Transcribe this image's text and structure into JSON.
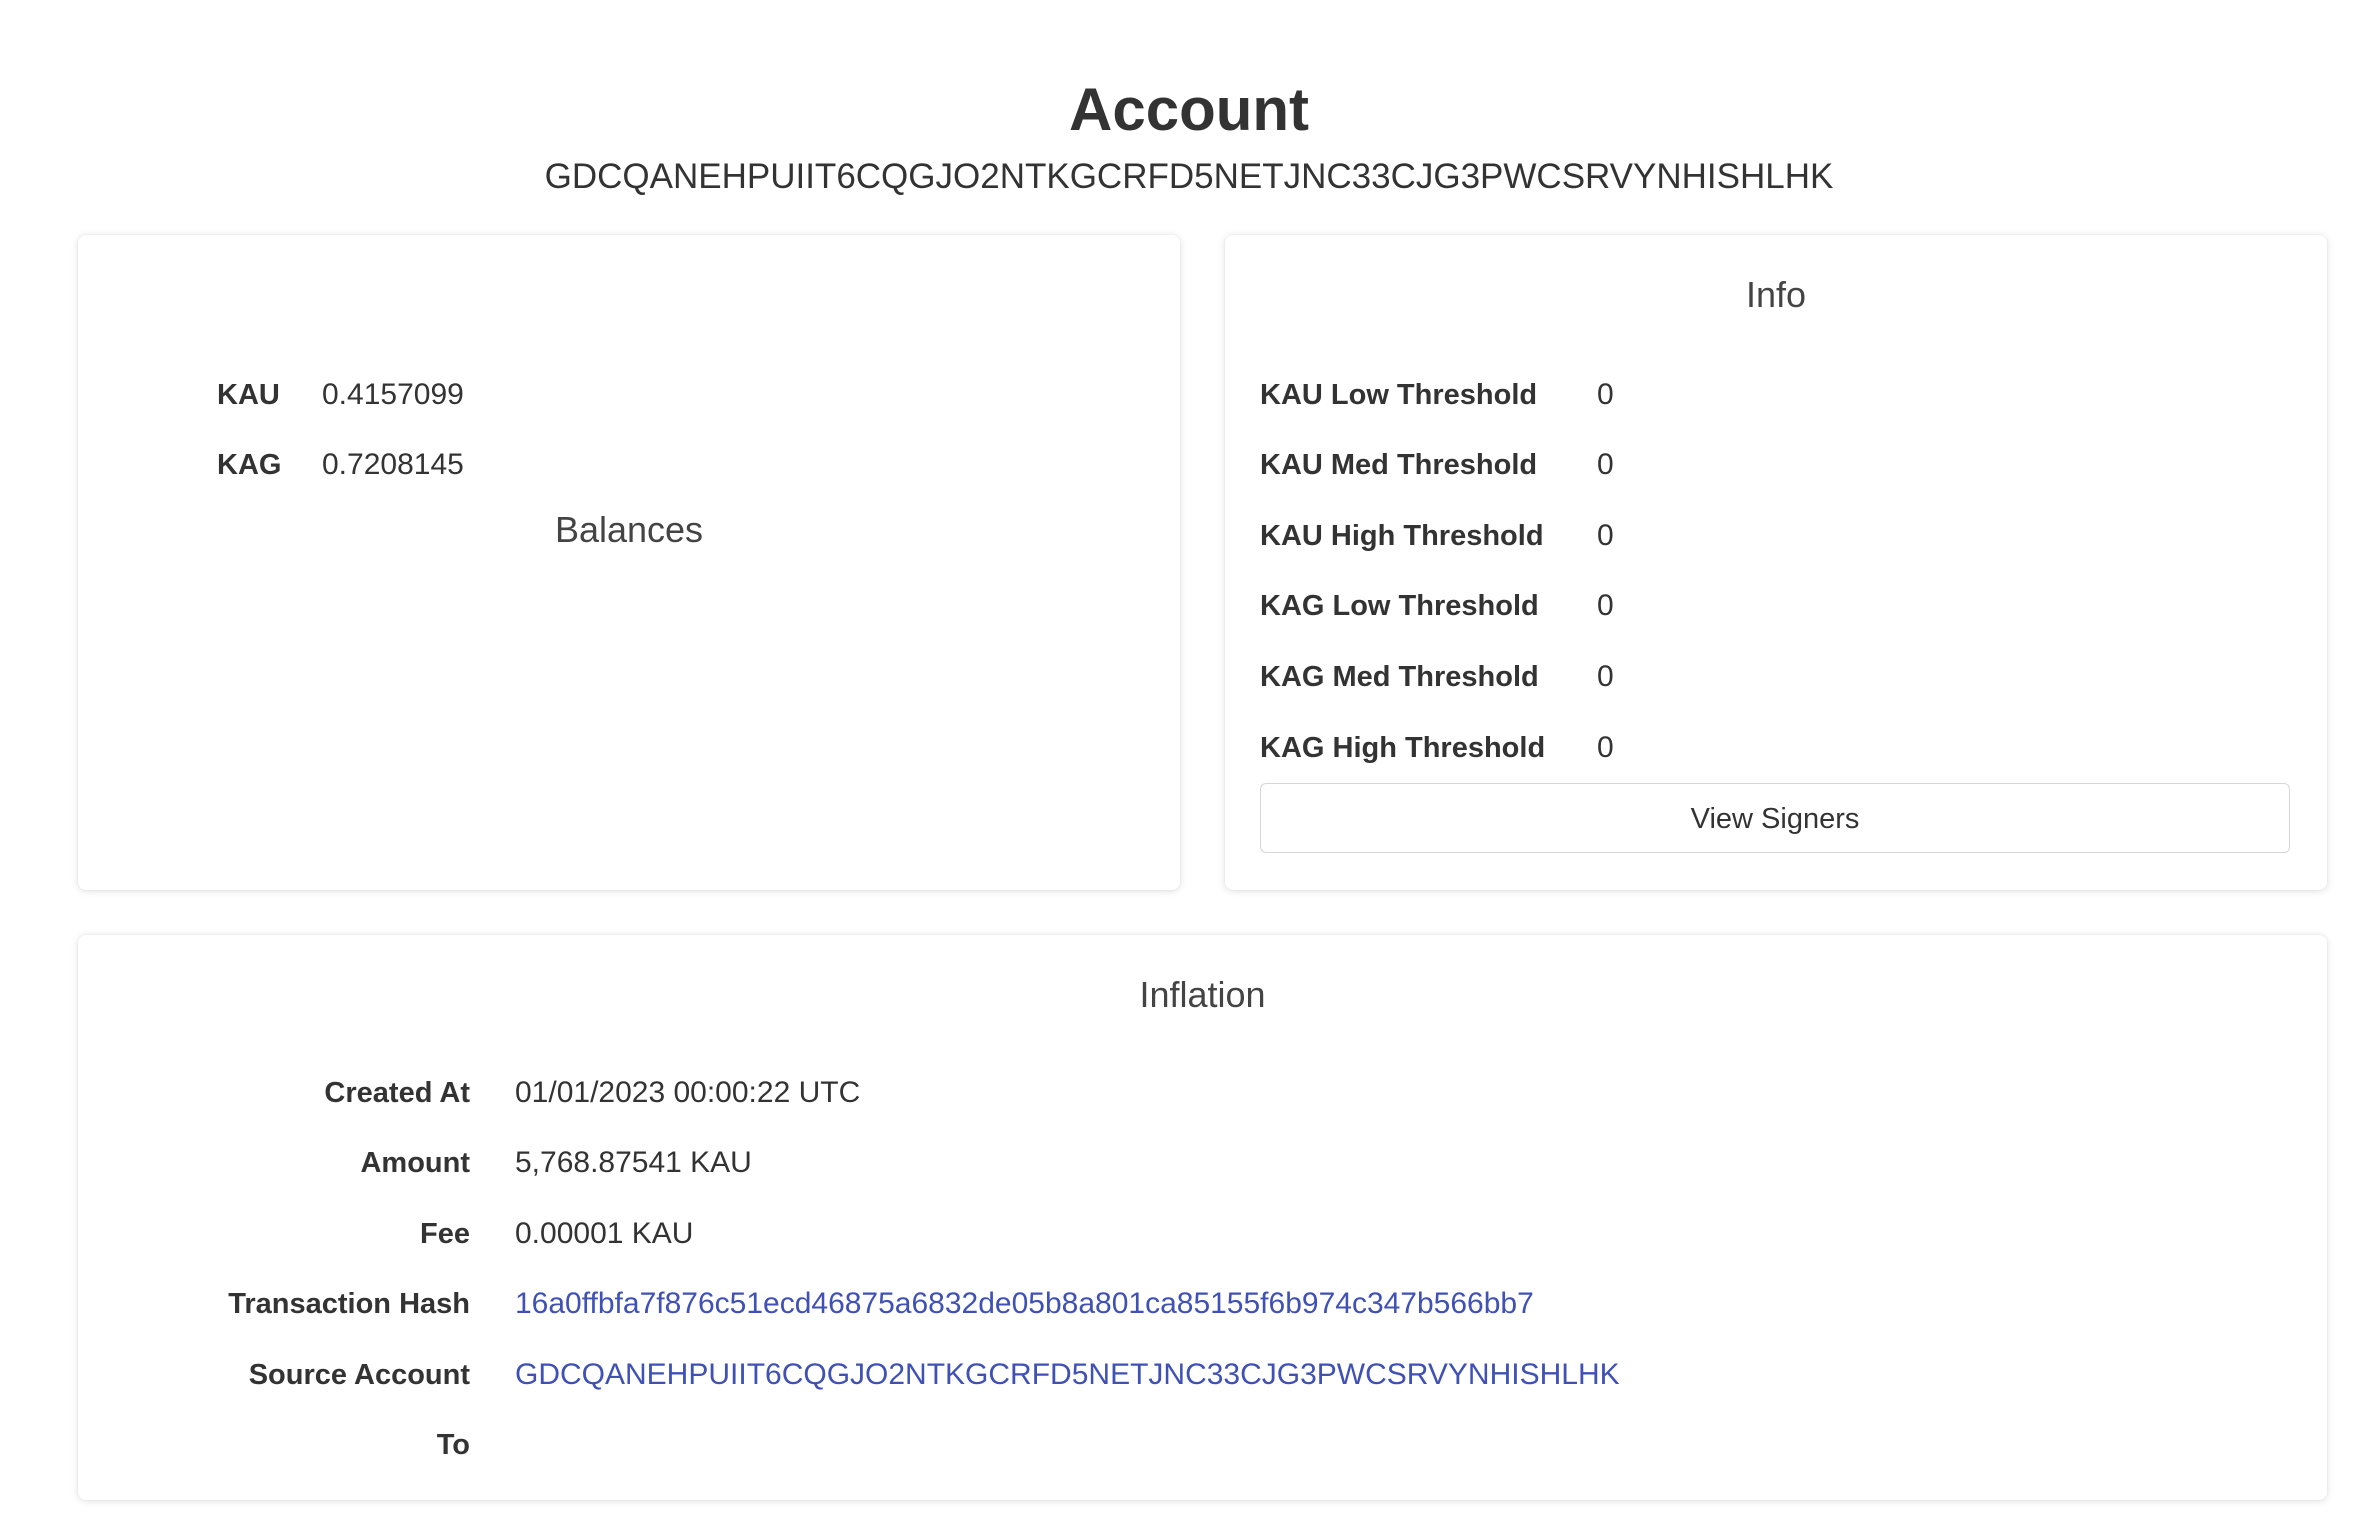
{
  "header": {
    "title": "Account",
    "account_id": "GDCQANEHPUIIT6CQGJO2NTKGCRFD5NETJNC33CJG3PWCSRVYNHISHLHK"
  },
  "balances": {
    "title": "Balances",
    "items": [
      {
        "label": "KAU",
        "value": "0.4157099"
      },
      {
        "label": "KAG",
        "value": "0.7208145"
      }
    ]
  },
  "info": {
    "title": "Info",
    "items": [
      {
        "label": "KAU Low Threshold",
        "value": "0"
      },
      {
        "label": "KAU Med Threshold",
        "value": "0"
      },
      {
        "label": "KAU High Threshold",
        "value": "0"
      },
      {
        "label": "KAG Low Threshold",
        "value": "0"
      },
      {
        "label": "KAG Med Threshold",
        "value": "0"
      },
      {
        "label": "KAG High Threshold",
        "value": "0"
      }
    ],
    "view_signers_label": "View Signers"
  },
  "inflation": {
    "title": "Inflation",
    "created_at_label": "Created At",
    "created_at": "01/01/2023 00:00:22 UTC",
    "amount_label": "Amount",
    "amount": "5,768.87541 KAU",
    "fee_label": "Fee",
    "fee": "0.00001 KAU",
    "tx_hash_label": "Transaction Hash",
    "tx_hash": "16a0ffbfa7f876c51ecd46875a6832de05b8a801ca85155f6b974c347b566bb7",
    "source_account_label": "Source Account",
    "source_account": "GDCQANEHPUIIT6CQGJO2NTKGCRFD5NETJNC33CJG3PWCSRVYNHISHLHK",
    "to_label": "To",
    "to": ""
  },
  "colors": {
    "link": "#3f51b5",
    "text": "#333333",
    "background": "#ffffff"
  }
}
